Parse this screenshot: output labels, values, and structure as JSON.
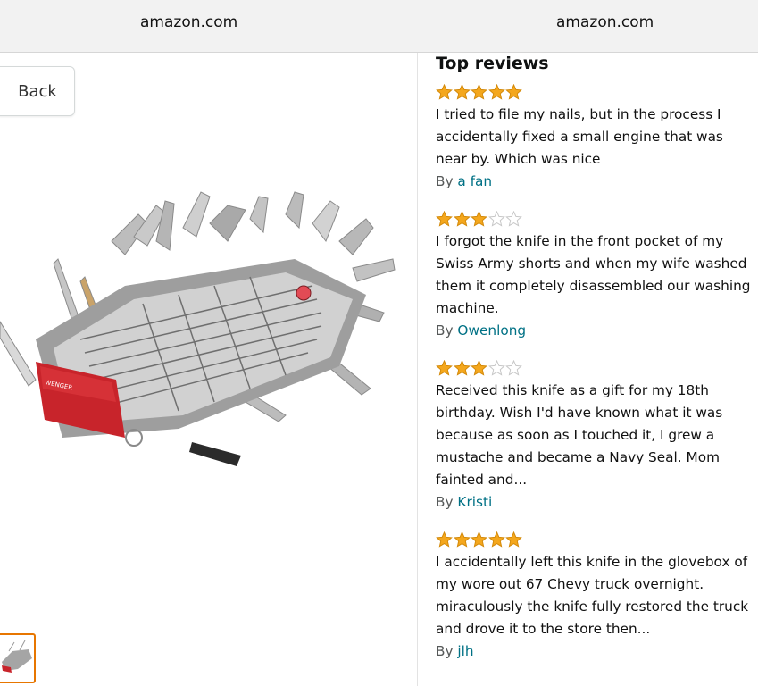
{
  "header": {
    "left_domain": "amazon.com",
    "right_domain": "amazon.com"
  },
  "left": {
    "back_label": "Back",
    "product_image": "swiss-army-knife-image"
  },
  "reviews": {
    "title": "Top reviews",
    "by_label": "By",
    "items": [
      {
        "stars": 5,
        "text": "I tried to file my nails, but in the process I accidentally fixed a small engine that was near by. Which was nice",
        "author": "a fan"
      },
      {
        "stars": 3,
        "text": "I forgot the knife in the front pocket of my Swiss Army shorts and when my wife washed them it completely disassembled our washing machine.",
        "author": "Owenlong"
      },
      {
        "stars": 3,
        "text": "Received this knife as a gift for my 18th birthday. Wish I'd have known what it was because as soon as I touched it, I grew a mustache and became a Navy Seal. Mom fainted and...",
        "author": "Kristi"
      },
      {
        "stars": 5,
        "text": "I accidentally left this knife in the glovebox of my wore out 67 Chevy truck overnight. miraculously the knife fully restored the truck and drove it to the store then...",
        "author": "jlh"
      }
    ]
  },
  "colors": {
    "star_filled": "#f4a71d",
    "star_outline": "#c7c7c7",
    "link": "#007185",
    "thumb_border": "#e77600"
  }
}
